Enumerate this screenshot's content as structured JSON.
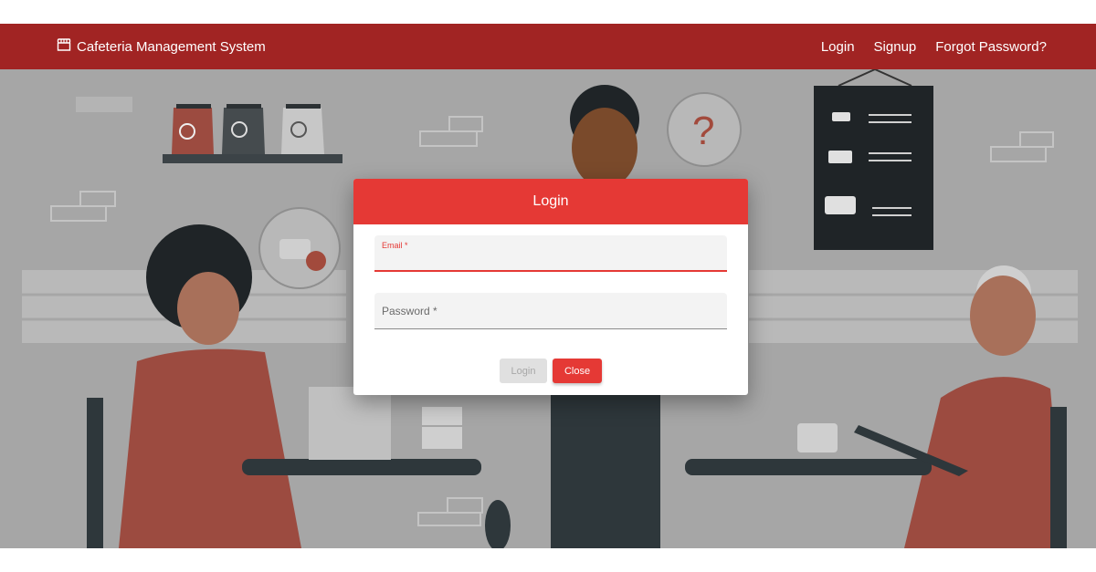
{
  "navbar": {
    "brand": "Cafeteria Management System",
    "brand_icon": "storefront-icon",
    "links": [
      "Login",
      "Signup",
      "Forgot Password?"
    ],
    "bg_color": "#a12423"
  },
  "dialog": {
    "title": "Login",
    "header_color": "#e53935",
    "email_label": "Email *",
    "email_value": "",
    "password_label": "Password *",
    "password_value": "",
    "login_button": "Login",
    "close_button": "Close"
  },
  "background": {
    "illustration": "cafe scene with customers and barista",
    "question_mark": "?"
  }
}
